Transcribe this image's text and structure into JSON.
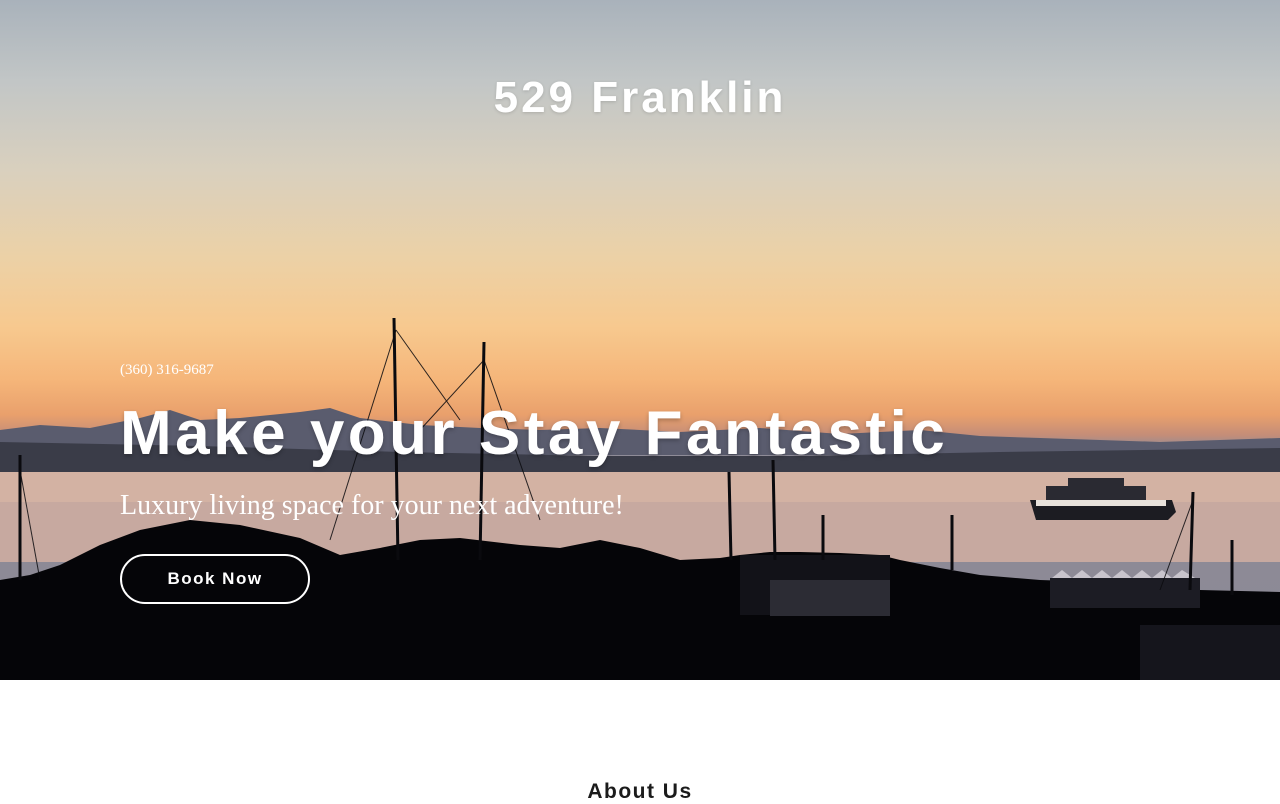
{
  "header": {
    "site_title": "529 Franklin"
  },
  "hero": {
    "phone": "(360) 316-9687",
    "headline": "Make your Stay Fantastic",
    "tagline": "Luxury living space for your next adventure!",
    "cta_label": "Book Now",
    "background": "sunset-harbor-photo"
  },
  "about": {
    "title": "About Us"
  },
  "colors": {
    "text_light": "#ffffff",
    "text_dark": "#1b1b1b",
    "page_bg": "#ffffff"
  }
}
